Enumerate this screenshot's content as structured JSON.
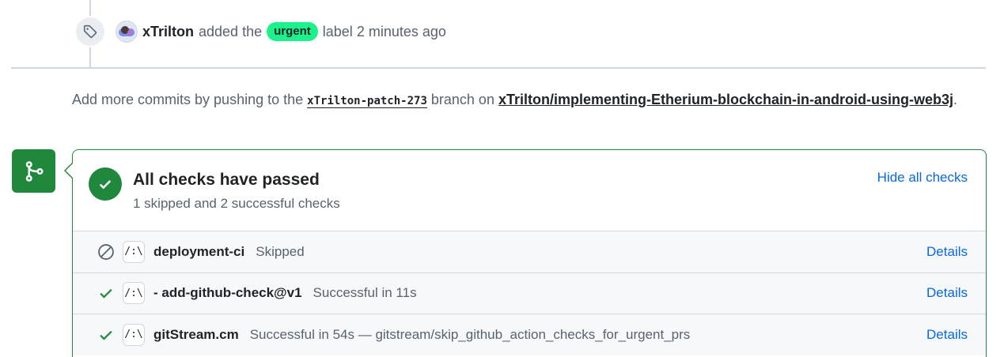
{
  "event": {
    "icon": "tag-icon",
    "author": "xTrilton",
    "action": "added the",
    "label": "urgent",
    "label_color": "#1cf28c",
    "suffix": "label",
    "time": "2 minutes ago"
  },
  "hint": {
    "prefix": "Add more commits by pushing to the",
    "branch": "xTrilton-patch-273",
    "middle": "branch on",
    "repo": "xTrilton/implementing-Etherium-blockchain-in-android-using-web3j",
    "period": "."
  },
  "checks": {
    "title": "All checks have passed",
    "subtitle": "1 skipped and 2 successful checks",
    "hide_label": "Hide all checks",
    "accent": "#1f883d",
    "link_color": "#0969da",
    "rows": [
      {
        "status": "skipped",
        "status_icon": "skip-icon",
        "app_icon": "/:\\",
        "name": "deployment-ci",
        "desc": "Skipped",
        "details": "Details"
      },
      {
        "status": "success",
        "status_icon": "check-icon",
        "app_icon": "/:\\",
        "name": "- add-github-check@v1",
        "desc": "Successful in 11s",
        "details": "Details"
      },
      {
        "status": "success",
        "status_icon": "check-icon",
        "app_icon": "/:\\",
        "name": "gitStream.cm",
        "desc": "Successful in 54s — gitstream/skip_github_action_checks_for_urgent_prs",
        "details": "Details"
      }
    ]
  }
}
